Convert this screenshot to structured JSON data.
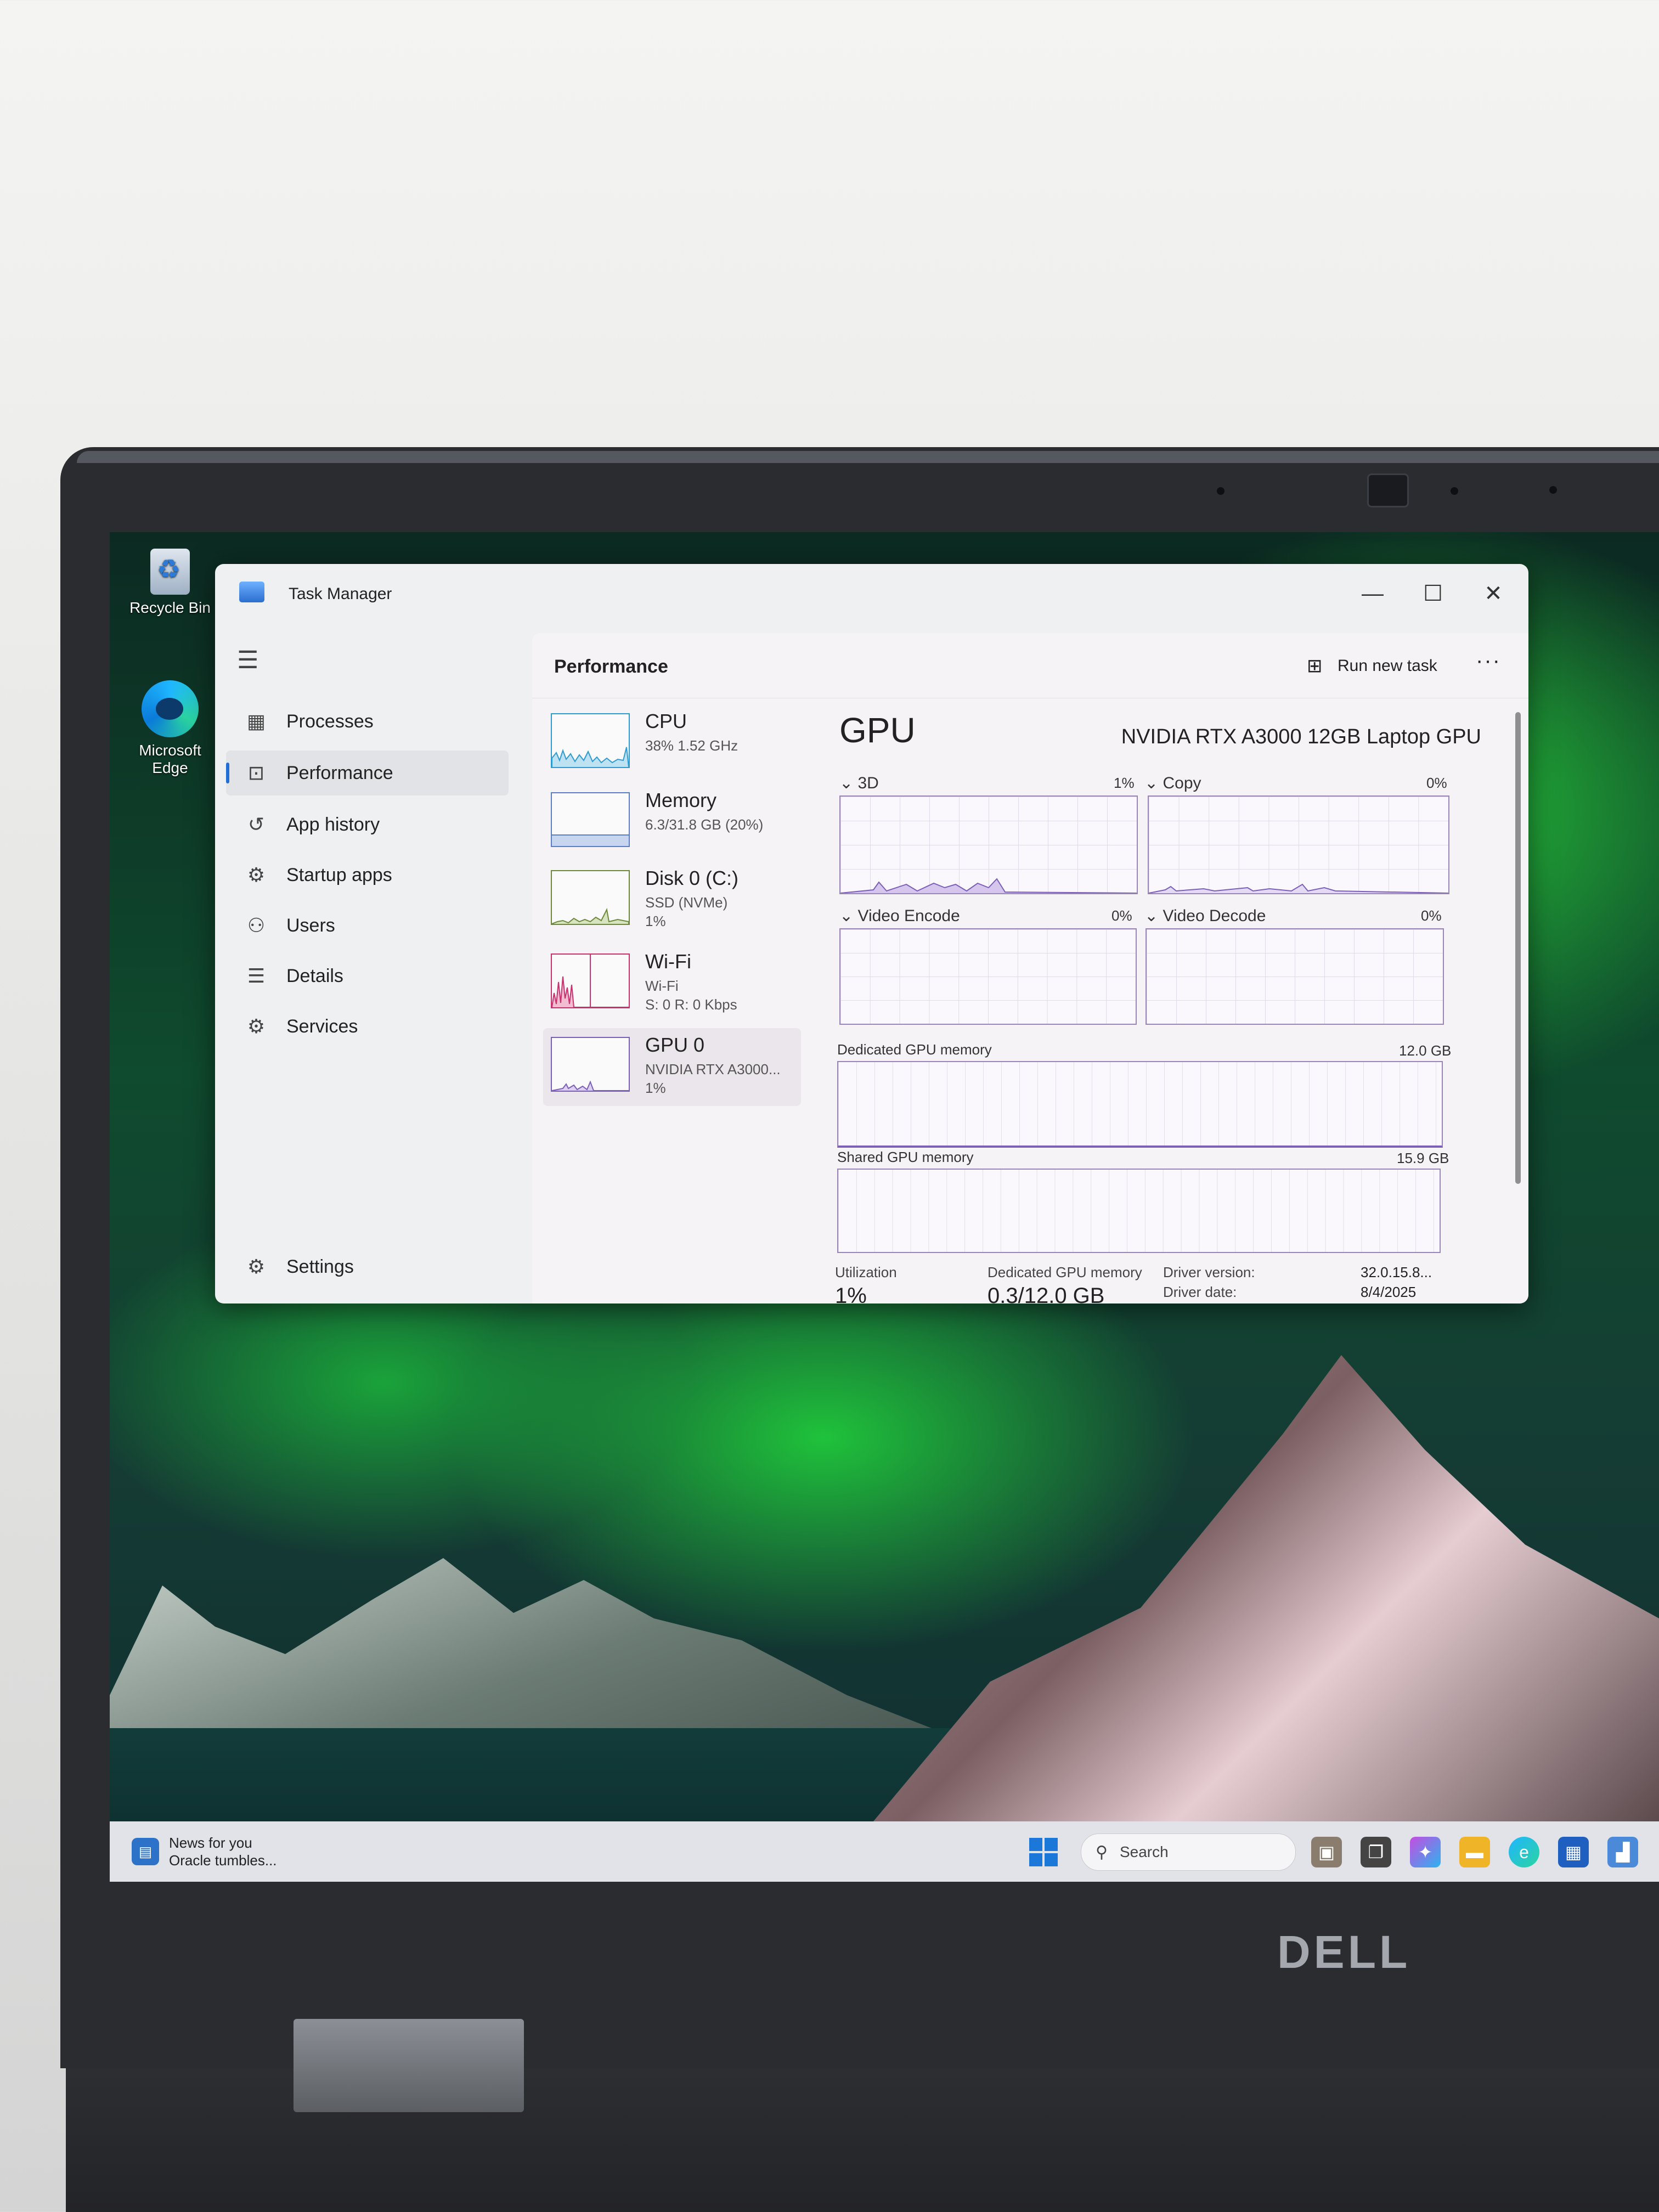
{
  "desktop": {
    "icons": [
      {
        "label": "Recycle Bin",
        "icon": "recycle-bin-icon"
      },
      {
        "label": "Microsoft Edge",
        "icon": "edge-icon"
      }
    ]
  },
  "window": {
    "title": "Task Manager",
    "controls": {
      "minimize": "—",
      "maximize": "☐",
      "close": "✕"
    }
  },
  "sidebar": {
    "items": [
      {
        "label": "Processes",
        "icon": "processes-icon"
      },
      {
        "label": "Performance",
        "icon": "performance-icon",
        "active": true
      },
      {
        "label": "App history",
        "icon": "history-icon"
      },
      {
        "label": "Startup apps",
        "icon": "startup-icon"
      },
      {
        "label": "Users",
        "icon": "users-icon"
      },
      {
        "label": "Details",
        "icon": "details-icon"
      },
      {
        "label": "Services",
        "icon": "services-icon"
      }
    ],
    "settings_label": "Settings"
  },
  "header": {
    "section_title": "Performance",
    "run_new_task": "Run new task",
    "more": "···"
  },
  "resources": [
    {
      "name": "CPU",
      "line1": "38% 1.52 GHz",
      "line2": "",
      "color": "#2f9bd0"
    },
    {
      "name": "Memory",
      "line1": "6.3/31.8 GB (20%)",
      "line2": "",
      "color": "#5a7fc4"
    },
    {
      "name": "Disk 0 (C:)",
      "line1": "SSD (NVMe)",
      "line2": "1%",
      "color": "#6d8a3a"
    },
    {
      "name": "Wi-Fi",
      "line1": "Wi-Fi",
      "line2": "S: 0 R: 0 Kbps",
      "color": "#c8326e"
    },
    {
      "name": "GPU 0",
      "line1": "NVIDIA RTX A3000...",
      "line2": "1%",
      "color": "#7b5fb8",
      "selected": true
    }
  ],
  "gpu": {
    "heading": "GPU",
    "model": "NVIDIA RTX A3000 12GB Laptop GPU",
    "engines": [
      {
        "label": "3D",
        "value": "1%"
      },
      {
        "label": "Copy",
        "value": "0%"
      },
      {
        "label": "Video Encode",
        "value": "0%"
      },
      {
        "label": "Video Decode",
        "value": "0%"
      }
    ],
    "dedicated_memory": {
      "label": "Dedicated GPU memory",
      "max": "12.0 GB"
    },
    "shared_memory": {
      "label": "Shared GPU memory",
      "max": "15.9 GB"
    },
    "stats": {
      "utilization_label": "Utilization",
      "utilization_value": "1%",
      "dedicated_label": "Dedicated GPU memory",
      "dedicated_value": "0.3/12.0 GB",
      "driver_version_label": "Driver version:",
      "driver_version_value": "32.0.15.8...",
      "driver_date_label": "Driver date:",
      "driver_date_value": "8/4/2025"
    }
  },
  "taskbar": {
    "news_title": "News for you",
    "news_sub": "Oracle tumbles...",
    "search_placeholder": "Search"
  },
  "brand": {
    "logo": "DELL"
  }
}
